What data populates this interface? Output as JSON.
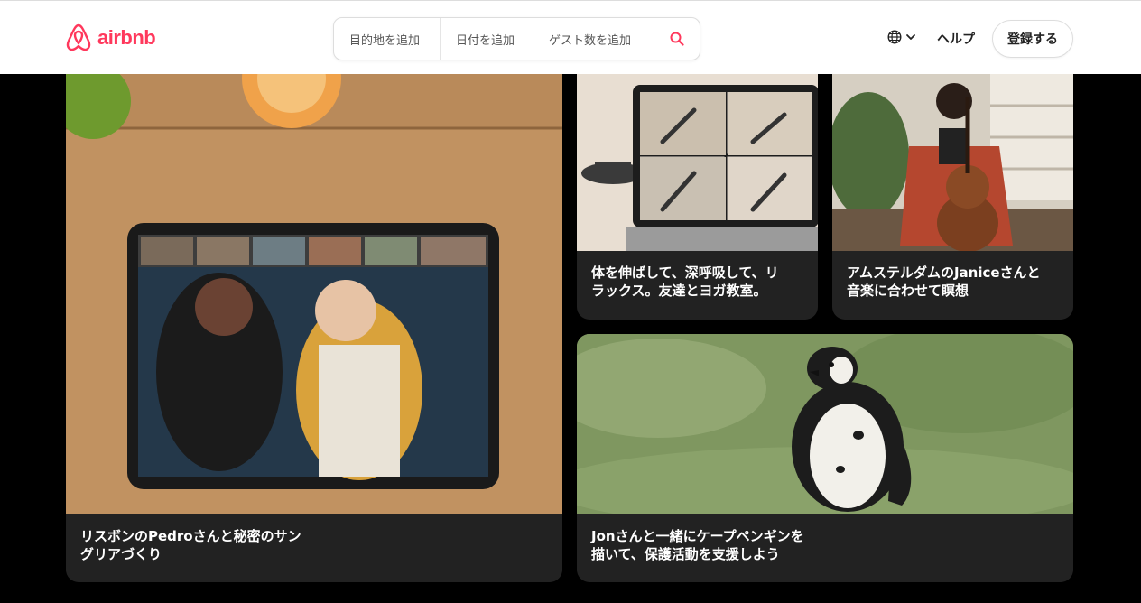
{
  "header": {
    "logo_text": "airbnb",
    "search": {
      "destination": "目的地を追加",
      "dates": "日付を追加",
      "guests": "ゲスト数を追加"
    },
    "help": "ヘルプ",
    "signup": "登録する"
  },
  "cards": [
    {
      "caption_line1": "リスボンのPedroさんと秘密のサン",
      "caption_line2": "グリアづくり"
    },
    {
      "caption_line1": "体を伸ばして、深呼吸して、リ",
      "caption_line2": "ラックス。友達とヨガ教室。"
    },
    {
      "caption_line1": "アムステルダムのJaniceさんと",
      "caption_line2": "音楽に合わせて瞑想"
    },
    {
      "caption_line1": "Jonさんと一緒にケープペンギンを",
      "caption_line2": "描いて、保護活動を支援しよう"
    }
  ],
  "colors": {
    "brand": "#ff385c",
    "card_bg": "#222222",
    "page_bg": "#000000"
  },
  "icons": [
    "airbnb-logo-icon",
    "search-icon",
    "globe-icon",
    "chevron-down-icon"
  ]
}
